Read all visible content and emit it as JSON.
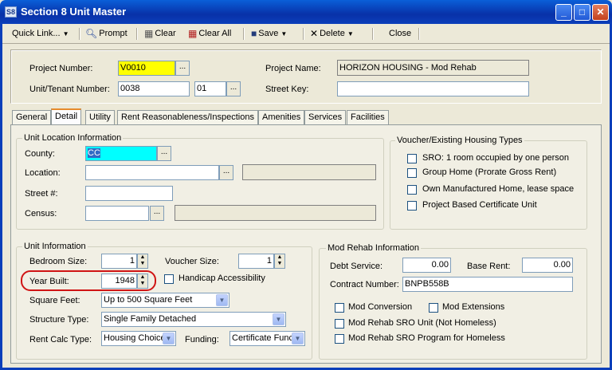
{
  "window": {
    "title": "Section 8 Unit Master",
    "app_icon": "S8"
  },
  "window_controls": {
    "minimize": "_",
    "maximize": "□",
    "close": "✕"
  },
  "toolbar": {
    "quick_link": "Quick Link...",
    "prompt": "Prompt",
    "clear": "Clear",
    "clear_all": "Clear All",
    "save": "Save",
    "delete": "Delete",
    "close": "Close"
  },
  "header": {
    "project_number_label": "Project Number:",
    "project_number": "V0010",
    "project_name_label": "Project Name:",
    "project_name": "HORIZON HOUSING - Mod Rehab",
    "unit_tenant_label": "Unit/Tenant Number:",
    "unit_number": "0038",
    "tenant_number": "01",
    "street_key_label": "Street Key:",
    "street_key": ""
  },
  "tabs": [
    "General",
    "Detail",
    "Utility",
    "Rent Reasonableness/Inspections",
    "Amenities",
    "Services",
    "Facilities"
  ],
  "unit_location": {
    "title": "Unit Location Information",
    "county_label": "County:",
    "county": "CC",
    "location_label": "Location:",
    "location": "",
    "location_desc": "",
    "street_label": "Street #:",
    "street": "",
    "census_label": "Census:",
    "census": "",
    "census_desc": ""
  },
  "voucher_types": {
    "title": "Voucher/Existing Housing Types",
    "items": [
      "SRO: 1 room occupied by one person",
      "Group Home (Prorate Gross Rent)",
      "Own Manufactured Home, lease space",
      "Project Based Certificate Unit"
    ]
  },
  "unit_info": {
    "title": "Unit Information",
    "bedroom_label": "Bedroom Size:",
    "bedroom": "1",
    "voucher_label": "Voucher Size:",
    "voucher": "1",
    "year_label": "Year Built:",
    "year": "1948",
    "handicap_label": "Handicap Accessibility",
    "sqft_label": "Square Feet:",
    "sqft": "Up to 500 Square Feet",
    "structure_label": "Structure Type:",
    "structure": "Single Family Detached",
    "rentcalc_label": "Rent Calc Type:",
    "rentcalc": "Housing Choice",
    "funding_label": "Funding:",
    "funding": "Certificate Func"
  },
  "mod_rehab": {
    "title": "Mod Rehab Information",
    "debt_label": "Debt Service:",
    "debt": "0.00",
    "base_label": "Base Rent:",
    "base": "0.00",
    "contract_label": "Contract Number:",
    "contract": "BNPB558B",
    "mod_conversion": "Mod Conversion",
    "mod_extensions": "Mod Extensions",
    "sro_unit": "Mod Rehab SRO Unit (Not Homeless)",
    "sro_program": "Mod Rehab SRO Program for Homeless"
  }
}
